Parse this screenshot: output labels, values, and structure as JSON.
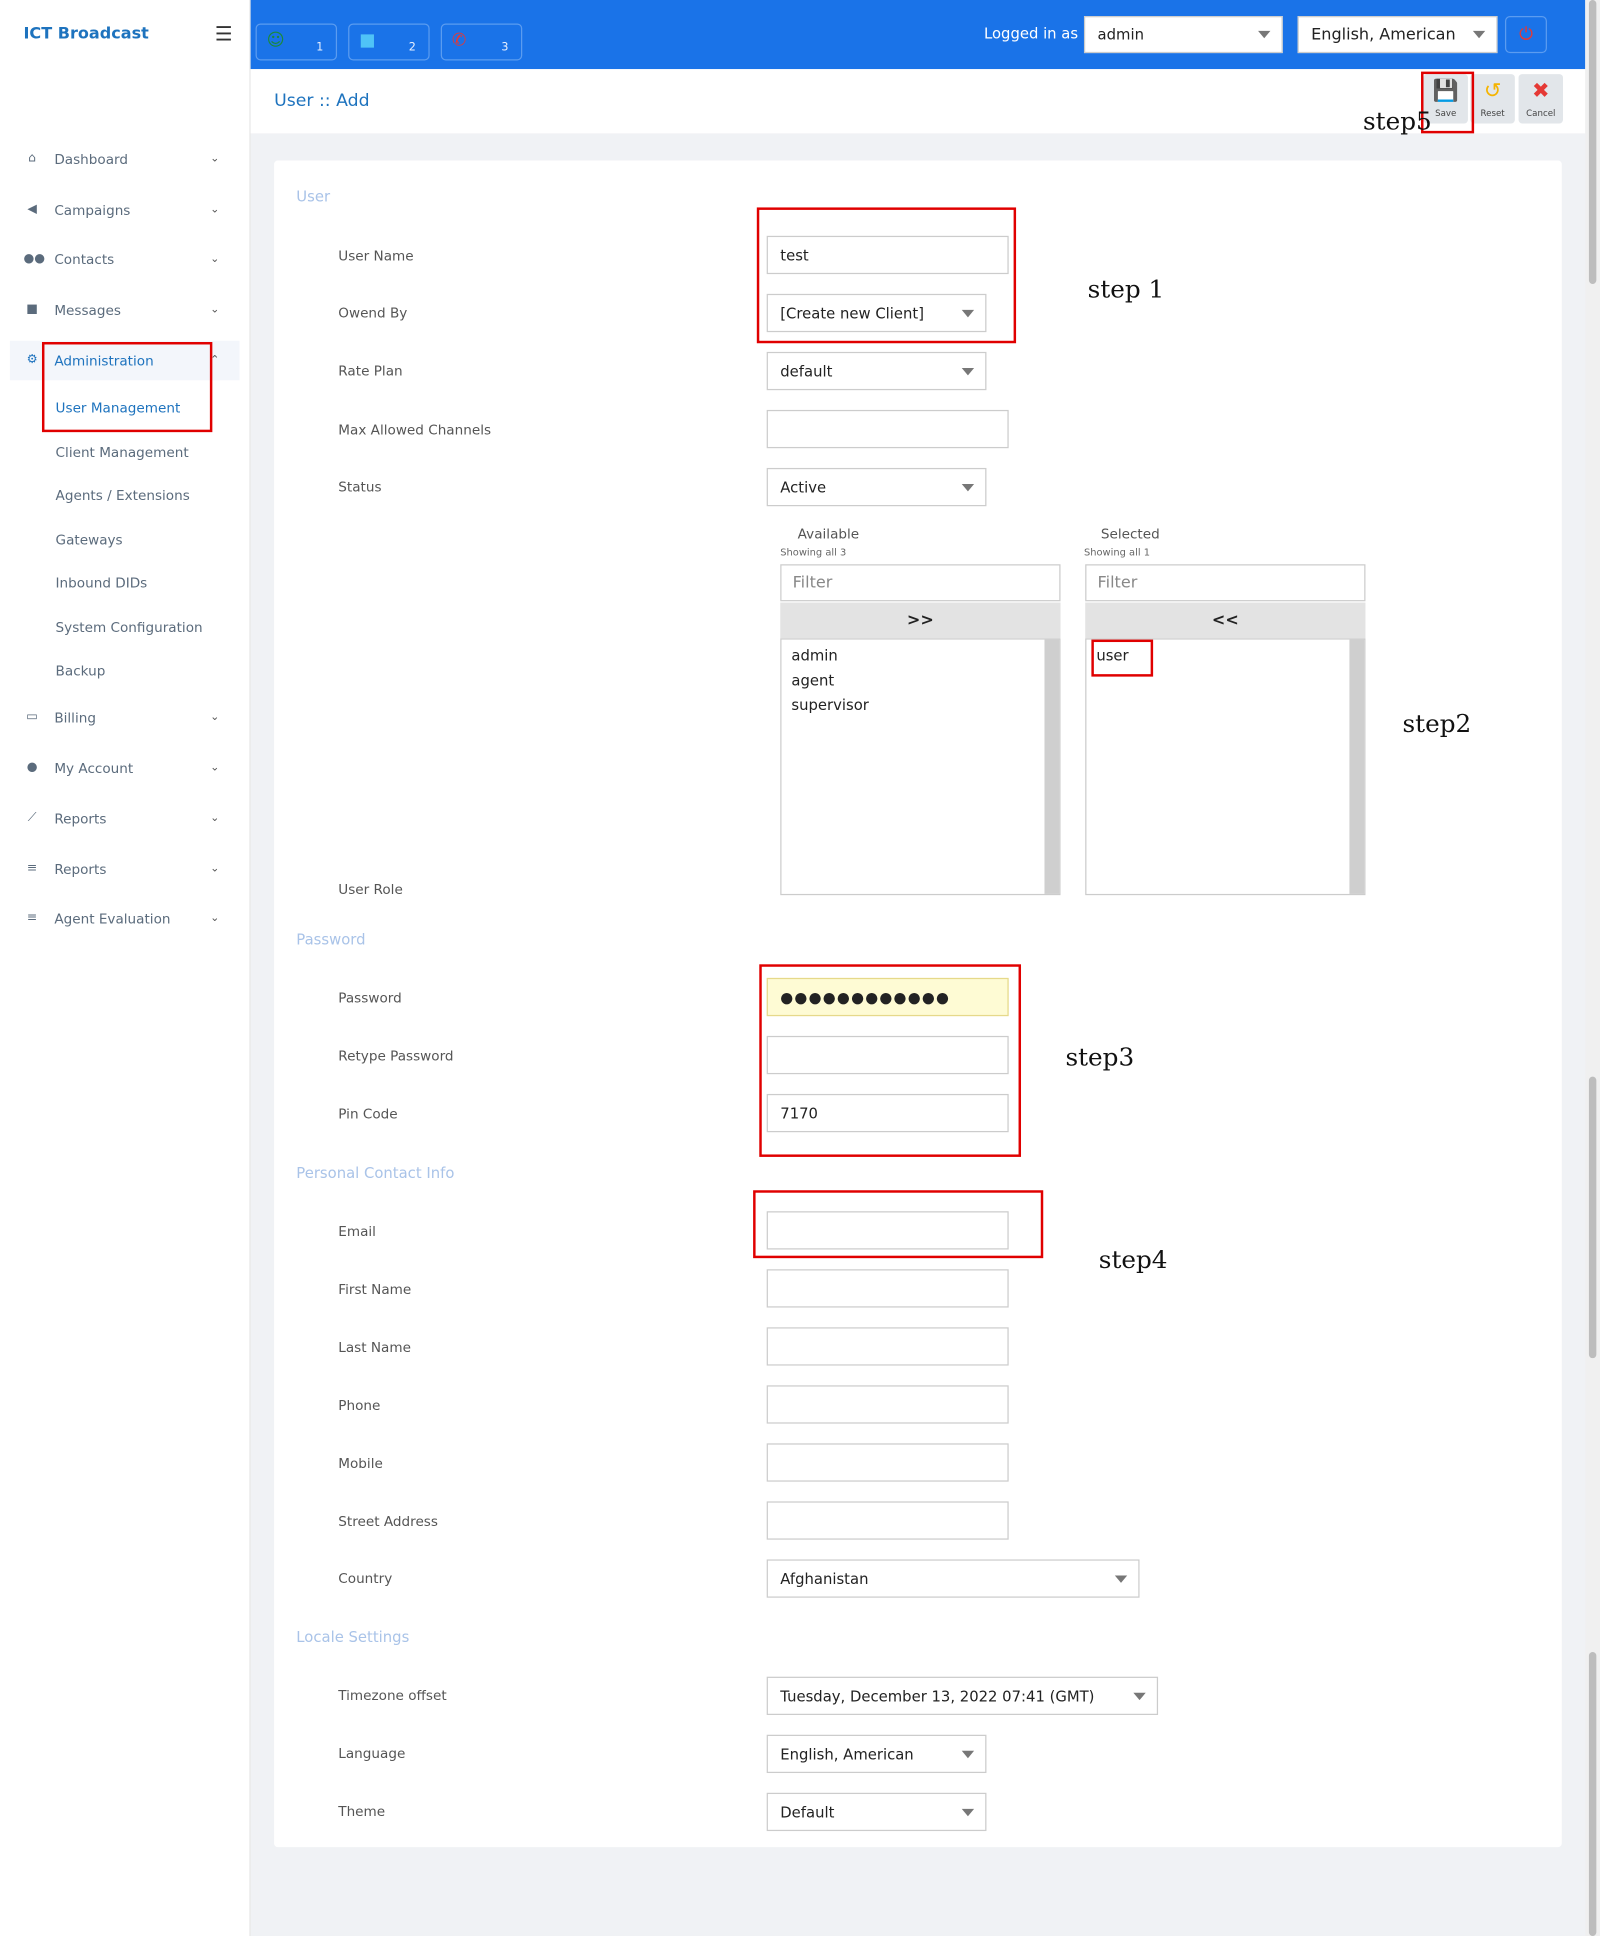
{
  "app": {
    "brand": "ICT Broadcast",
    "menu_icon": "hamburger-icon"
  },
  "sidebar": {
    "items": [
      {
        "label": "Dashboard",
        "icon": "home-icon"
      },
      {
        "label": "Campaigns",
        "icon": "megaphone-icon"
      },
      {
        "label": "Contacts",
        "icon": "users-icon"
      },
      {
        "label": "Messages",
        "icon": "comments-icon"
      },
      {
        "label": "Administration",
        "icon": "gears-icon"
      },
      {
        "label": "Billing",
        "icon": "money-icon"
      },
      {
        "label": "My Account",
        "icon": "user-icon"
      },
      {
        "label": "Reports",
        "icon": "chart-line-icon"
      },
      {
        "label": "Reports",
        "icon": "list-icon"
      },
      {
        "label": "Agent Evaluation",
        "icon": "list-check-icon"
      }
    ],
    "admin_sub": [
      "User Management",
      "Client Management",
      "Agents / Extensions",
      "Gateways",
      "Inbound DIDs",
      "System Configuration",
      "Backup"
    ]
  },
  "topbar": {
    "buttons": [
      {
        "icon": "agents-icon",
        "count": "1",
        "color": "#1b8a3a"
      },
      {
        "icon": "chat-icon",
        "count": "2",
        "color": "#29b6f6"
      },
      {
        "icon": "phone-off-icon",
        "count": "3",
        "color": "#e53935"
      }
    ],
    "logged_in_label": "Logged in as :",
    "logged_in_user": "admin",
    "language": "English, American"
  },
  "header": {
    "breadcrumb": "User :: Add",
    "actions": [
      {
        "label": "Save",
        "icon": "save-icon",
        "color": "#1a73e8"
      },
      {
        "label": "Reset",
        "icon": "undo-icon",
        "color": "#f5b400"
      },
      {
        "label": "Cancel",
        "icon": "close-icon",
        "color": "#e53935"
      }
    ]
  },
  "form": {
    "sections": {
      "user": "User",
      "password": "Password",
      "contact": "Personal Contact Info",
      "locale": "Locale Settings"
    },
    "labels": {
      "user_name": "User Name",
      "owned_by": "Owend By",
      "rate_plan": "Rate Plan",
      "max_channels": "Max Allowed Channels",
      "status": "Status",
      "user_role": "User Role",
      "password": "Password",
      "retype_password": "Retype Password",
      "pin_code": "Pin Code",
      "email": "Email",
      "first_name": "First Name",
      "last_name": "Last Name",
      "phone": "Phone",
      "mobile": "Mobile",
      "street": "Street Address",
      "country": "Country",
      "timezone": "Timezone offset",
      "language": "Language",
      "theme": "Theme"
    },
    "values": {
      "user_name": "test",
      "owned_by": "[Create new Client]",
      "rate_plan": "default",
      "max_channels": "",
      "status": "Active",
      "password": "●●●●●●●●●●●●",
      "retype_password": "",
      "pin_code": "7170",
      "email": "",
      "first_name": "",
      "last_name": "",
      "phone": "",
      "mobile": "",
      "street": "",
      "country": "Afghanistan",
      "timezone": "Tuesday, December 13, 2022 07:41 (GMT)",
      "language": "English, American",
      "theme": "Default"
    },
    "roles": {
      "available_title": "Available",
      "available_count": "Showing all 3",
      "selected_title": "Selected",
      "selected_count": "Showing all 1",
      "filter_placeholder": "Filter",
      "move_all_right": ">>",
      "move_all_left": "<<",
      "available": [
        "admin",
        "agent",
        "supervisor"
      ],
      "selected": [
        "user"
      ]
    }
  },
  "annotations": {
    "step1": "step 1",
    "step2": "step2",
    "step3": "step3",
    "step4": "step4",
    "step5": "step5"
  }
}
